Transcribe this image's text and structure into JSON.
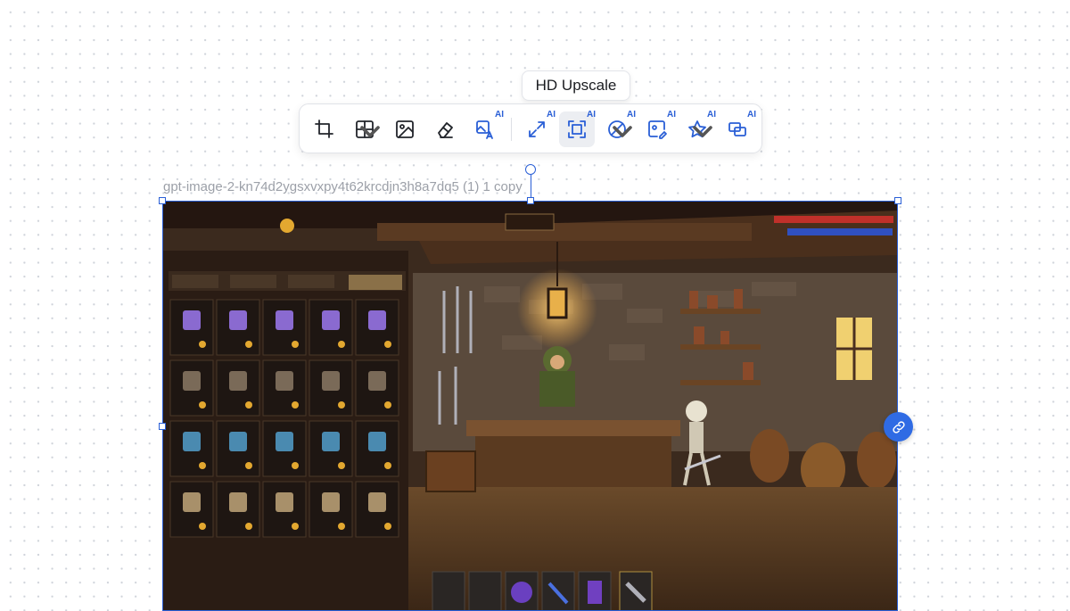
{
  "tooltip": {
    "label": "HD Upscale"
  },
  "toolbar": {
    "badge": "AI",
    "tools": [
      {
        "icon": "crop-icon",
        "ai": false,
        "dropdown": false,
        "active": false
      },
      {
        "icon": "grid-split-icon",
        "ai": false,
        "dropdown": true,
        "active": false
      },
      {
        "icon": "image-icon",
        "ai": false,
        "dropdown": false,
        "active": false
      },
      {
        "icon": "eraser-icon",
        "ai": false,
        "dropdown": false,
        "active": false
      },
      {
        "icon": "image-translate-icon",
        "ai": true,
        "dropdown": false,
        "active": false
      },
      {
        "icon": "expand-icon",
        "ai": true,
        "dropdown": false,
        "active": false
      },
      {
        "icon": "hd-upscale-icon",
        "ai": true,
        "dropdown": false,
        "active": true
      },
      {
        "icon": "remove-background-icon",
        "ai": true,
        "dropdown": true,
        "active": false
      },
      {
        "icon": "edit-image-icon",
        "ai": true,
        "dropdown": false,
        "active": false
      },
      {
        "icon": "star-icon",
        "ai": true,
        "dropdown": true,
        "active": false
      },
      {
        "icon": "layers-icon",
        "ai": true,
        "dropdown": false,
        "active": false
      }
    ]
  },
  "canvas": {
    "filename": "gpt-image-2-kn74d2ygsxvxpy4t62krcdjn3h8a7dq5 (1) 1 copy"
  },
  "colors": {
    "accent": "#2a5fd6",
    "link_button": "#2f6be4"
  }
}
